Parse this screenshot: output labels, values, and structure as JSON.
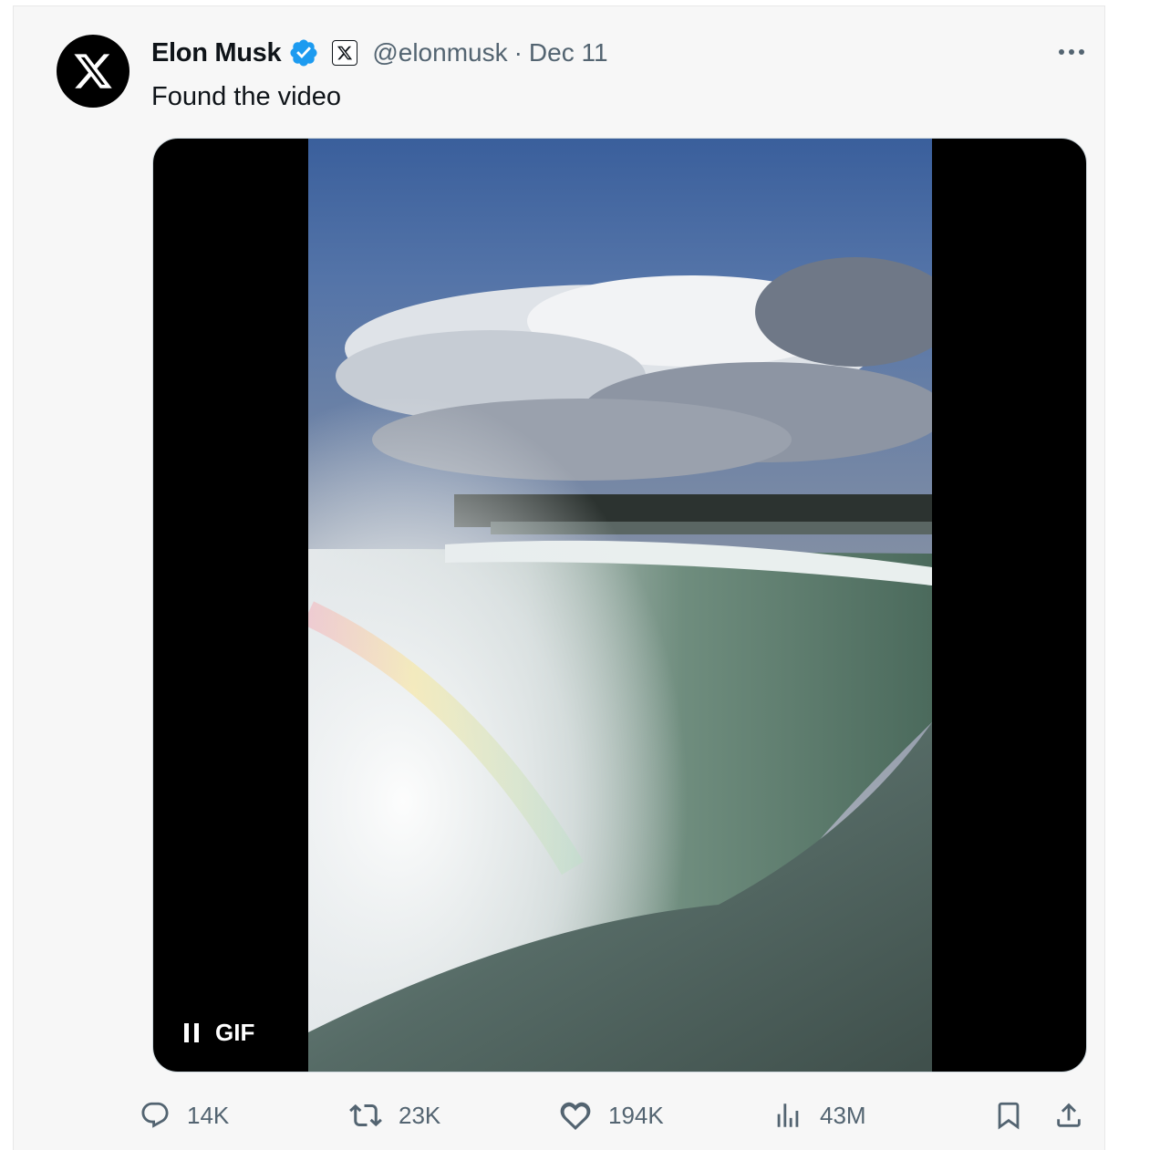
{
  "author": {
    "name": "Elon Musk",
    "handle": "@elonmusk",
    "separator": "·",
    "date": "Dec 11",
    "avatar_icon": "x-logo-icon",
    "verified_color": "#1d9bf0"
  },
  "tweet": {
    "text": "Found the video"
  },
  "media": {
    "badge_label": "GIF",
    "state": "playing"
  },
  "actions": {
    "replies": "14K",
    "reposts": "23K",
    "likes": "194K",
    "views": "43M"
  },
  "colors": {
    "muted_text": "#536471",
    "background": "#f7f7f7"
  }
}
